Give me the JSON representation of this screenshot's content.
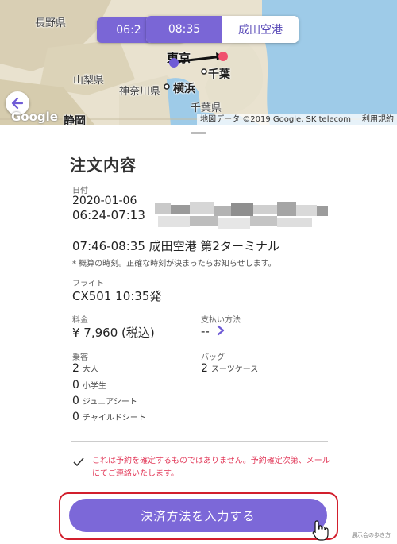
{
  "map": {
    "places": {
      "nagano": "長野県",
      "yamanashi": "山梨県",
      "kanagawa": "神奈川県",
      "shizuoka": "静岡",
      "tokyo": "東京",
      "chiba_city": "千葉",
      "yokohama": "横浜",
      "chiba_pref": "千葉県"
    },
    "google_logo": "Google",
    "copyright": "地図データ ©2019 Google, SK telecom",
    "terms": "利用規約",
    "depart_time_partial": "06:2",
    "arrive_time": "08:35",
    "arrive_place": "成田空港",
    "colors": {
      "route_start": "#6f5bd6",
      "route_end": "#f0506e",
      "route_line": "#111111"
    }
  },
  "order": {
    "title": "注文内容",
    "date_label": "日付",
    "date": "2020-01-06",
    "depart_time_range": "06:24-07:13",
    "arrive_line": "07:46-08:35  成田空港 第2ターミナル",
    "note": "* 概算の時刻。正確な時刻が決まったらお知らせします。",
    "flight_label": "フライト",
    "flight": "CX501 10:35発",
    "fare_label": "料金",
    "fare": "¥ 7,960 (税込)",
    "payment_label": "支払い方法",
    "payment_value": "--",
    "passengers_label": "乗客",
    "passengers": [
      {
        "count": "2",
        "type": "大人"
      },
      {
        "count": "0",
        "type": "小学生"
      },
      {
        "count": "0",
        "type": "ジュニアシート"
      },
      {
        "count": "0",
        "type": "チャイルドシート"
      }
    ],
    "baggage_label": "バッグ",
    "baggage_count": "2",
    "baggage_type": "スーツケース",
    "warning": "これは予約を確定するものではありません。予約確定次第、メールにてご連絡いたします。",
    "cta": "決済方法を入力する"
  },
  "accent_color": "#7c68d8",
  "warning_color": "#e23a5a",
  "watermark": "展示会の歩き方"
}
